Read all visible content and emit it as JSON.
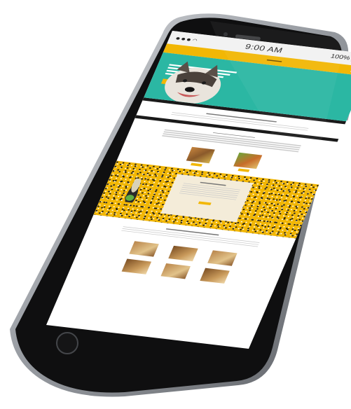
{
  "status_bar": {
    "time": "9:00 AM",
    "battery": "100%"
  },
  "colors": {
    "phone_body": "#0f0f10",
    "phone_frame": "#b9bcc1",
    "brand_yellow": "#f2b705",
    "hero_teal": "#2bb7a3"
  },
  "icons": [
    "signal-icon",
    "wifi-icon",
    "battery-icon",
    "home-button-icon",
    "camera-icon",
    "speaker-icon"
  ]
}
